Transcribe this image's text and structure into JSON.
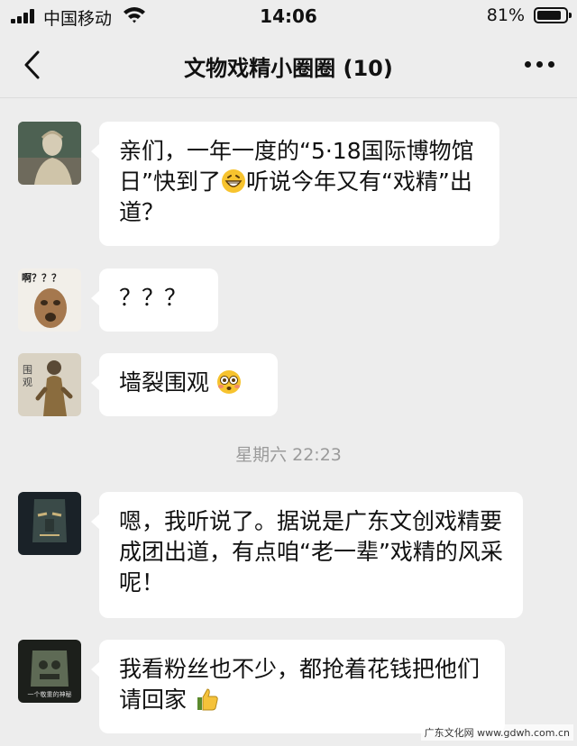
{
  "status": {
    "carrier": "中国移动",
    "time": "14:06",
    "battery_pct": "81%",
    "battery_level": 0.81
  },
  "nav": {
    "title": "文物戏精小圈圈 (10)"
  },
  "messages": [
    {
      "parts": [
        "亲们，一年一度的“5·18国际博物馆日”快到了",
        "听说今年又有“戏精”出道？"
      ],
      "emoji": "grinning-face"
    },
    {
      "parts": [
        "？？？"
      ]
    },
    {
      "parts": [
        "墙裂围观"
      ],
      "emoji": "flushed-face"
    },
    {
      "parts": [
        "嗯，我听说了。据说是广东文创戏精要成团出道，有点咱“老一辈”戏精的风采呢！"
      ]
    },
    {
      "parts": [
        "我看粉丝也不少，都抢着花钱把他们请回家"
      ],
      "emoji": "thumbs-up"
    }
  ],
  "avatars": {
    "a2_caption": "啊？？？",
    "a3_caption": "围观",
    "a5_caption": "一个敬重的神秘"
  },
  "timestamp": "星期六 22:23",
  "watermark": "广东文化网 www.gdwh.com.cn",
  "colors": {
    "background": "#ededed",
    "bubble": "#ffffff",
    "timestamp": "#9a9a9a"
  }
}
